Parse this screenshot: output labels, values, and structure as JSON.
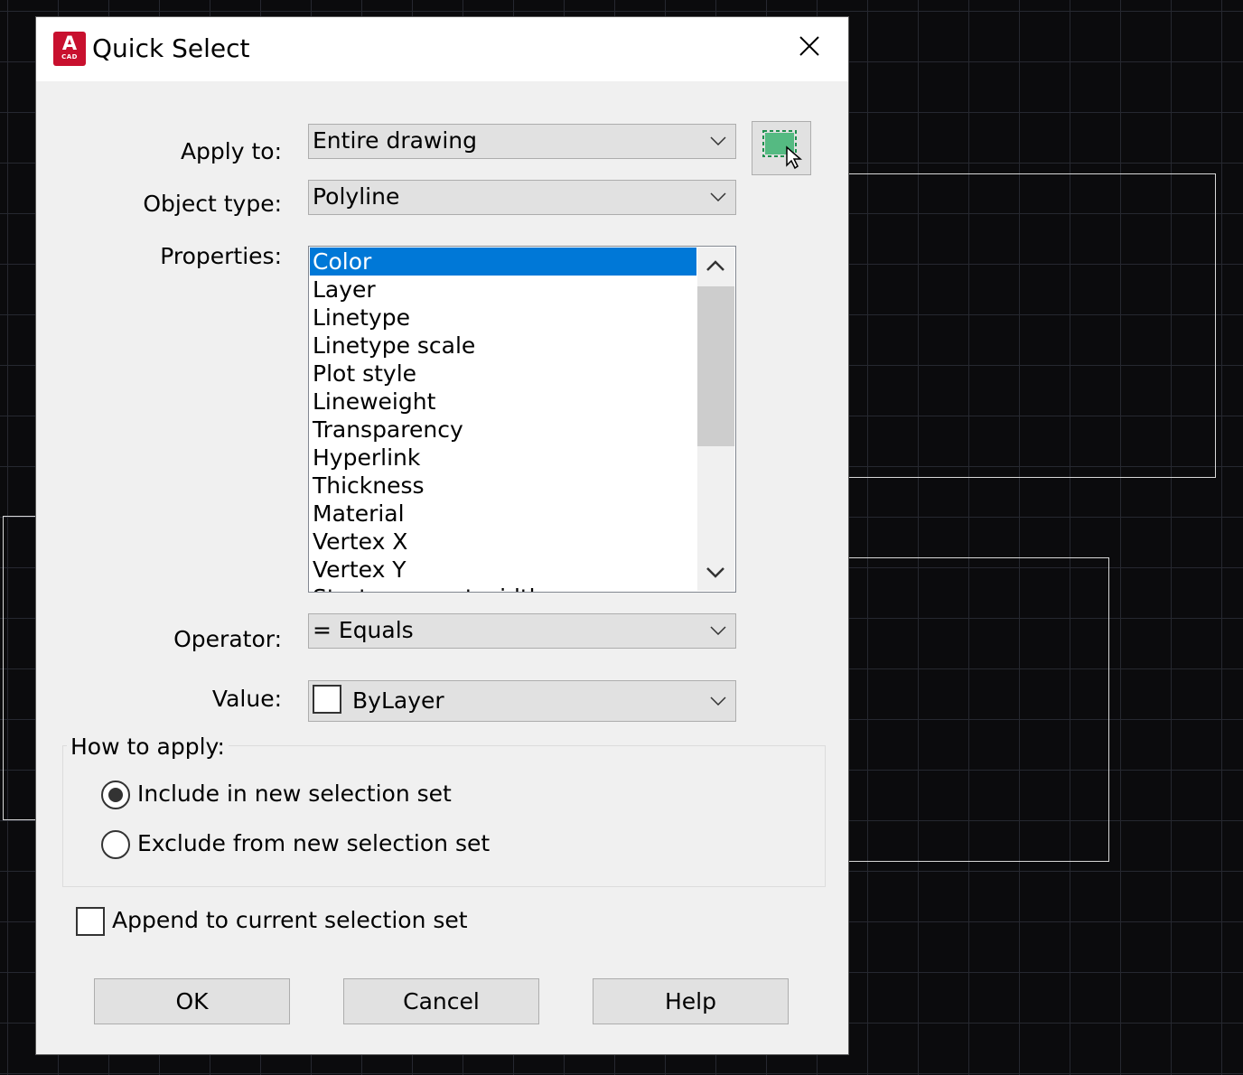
{
  "dialog": {
    "title": "Quick Select",
    "app_icon": {
      "letter": "A",
      "caption": "CAD",
      "color": "#c8102e",
      "name": "autocad-icon"
    }
  },
  "apply_to": {
    "label": "Apply to:",
    "value": "Entire drawing"
  },
  "object_type": {
    "label": "Object type:",
    "value": "Polyline"
  },
  "properties": {
    "label": "Properties:",
    "selected": "Color",
    "items": [
      "Color",
      "Layer",
      "Linetype",
      "Linetype scale",
      "Plot style",
      "Lineweight",
      "Transparency",
      "Hyperlink",
      "Thickness",
      "Material",
      "Vertex X",
      "Vertex Y",
      "Start segment width"
    ]
  },
  "operator": {
    "label": "Operator:",
    "value": "= Equals"
  },
  "value": {
    "label": "Value:",
    "value": "ByLayer",
    "swatch_color": "#ffffff"
  },
  "how_to_apply": {
    "legend": "How to apply:",
    "options": [
      {
        "label": "Include in new selection set",
        "checked": true
      },
      {
        "label": "Exclude from new selection set",
        "checked": false
      }
    ]
  },
  "append": {
    "label": "Append to current selection set",
    "checked": false
  },
  "buttons": {
    "ok": "OK",
    "cancel": "Cancel",
    "help": "Help"
  },
  "colors": {
    "accent": "#0078d7",
    "select_icon": "#3cb371"
  }
}
